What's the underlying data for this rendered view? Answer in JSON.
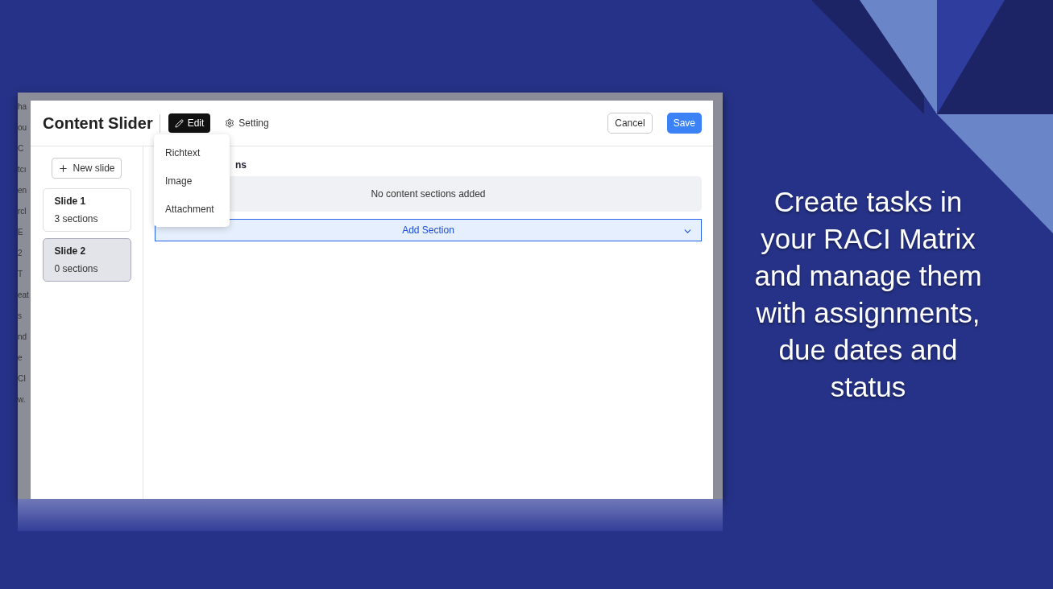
{
  "background_fragments": [
    "ha",
    "ou",
    "C",
    "tcı",
    "en",
    "rcl",
    "E",
    "2",
    "T",
    "eat",
    "s",
    "nd",
    "e",
    "CI",
    "w."
  ],
  "dialog": {
    "title": "Content Slider",
    "tabs": [
      {
        "label": "Edit",
        "selected": true
      },
      {
        "label": "Setting",
        "selected": false
      }
    ],
    "buttons": [
      {
        "label": "Cancel",
        "kind": "secondary"
      },
      {
        "label": "Save",
        "kind": "primary"
      }
    ],
    "new_slide": "New slide",
    "slides": [
      {
        "title": "Slide 1",
        "subtitle": "3 sections",
        "selected": false
      },
      {
        "title": "Slide 2",
        "subtitle": "0 sections",
        "selected": true
      }
    ],
    "heading": "ns",
    "empty_message": "No content sections added",
    "add_section": "Add Section",
    "menu": [
      "Richtext",
      "Image",
      "Attachment"
    ]
  },
  "caption": "Create tasks in your RACI Matrix and manage them with assignments, due dates and status"
}
